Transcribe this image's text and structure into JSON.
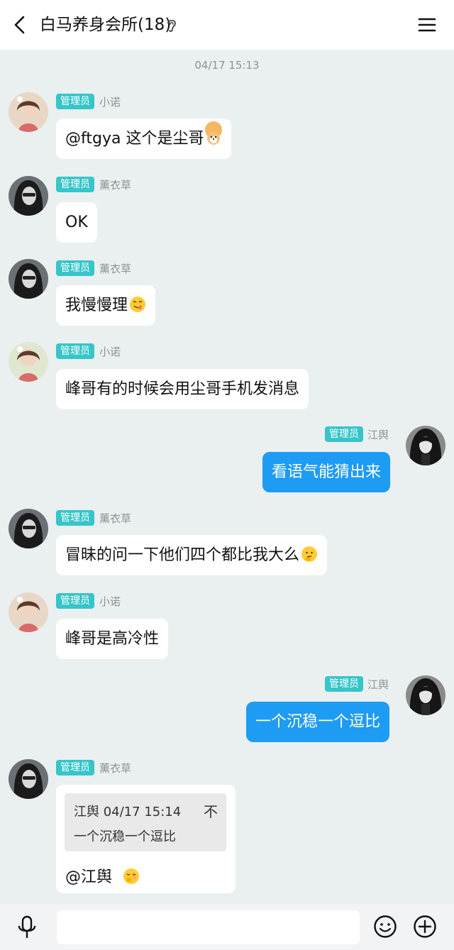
{
  "header": {
    "title": "白马养身会所(18)"
  },
  "timestamp": "04/17 15:13",
  "messages": [
    {
      "badge": "管理员",
      "sender": "小诺",
      "text": "@ftgya 这个是尘哥",
      "emoji": "dog-face-emoji"
    },
    {
      "badge": "管理员",
      "sender": "薰衣草",
      "text": "OK"
    },
    {
      "badge": "管理员",
      "sender": "薰衣草",
      "text": "我慢慢理",
      "emoji": "yum-face-emoji"
    },
    {
      "badge": "管理员",
      "sender": "小诺",
      "text": "峰哥有的时候会用尘哥手机发消息"
    },
    {
      "badge": "管理员",
      "sender": "江舆",
      "text": "看语气能猜出来"
    },
    {
      "badge": "管理员",
      "sender": "薰衣草",
      "text": "冒昧的问一下他们四个都比我大么",
      "emoji": "thinking-face-emoji"
    },
    {
      "badge": "管理员",
      "sender": "小诺",
      "text": "峰哥是高冷性"
    },
    {
      "badge": "管理员",
      "sender": "江舆",
      "text": "一个沉稳一个逗比"
    },
    {
      "badge": "管理员",
      "sender": "薰衣草",
      "quote": {
        "author_time": "江舆 04/17 15:14",
        "arrow": "不",
        "text": "一个沉稳一个逗比"
      },
      "text": "@江舆",
      "emoji": "shy-face-emoji"
    }
  ],
  "colors": {
    "background": "#eaeff0",
    "badge": "#36c5c9",
    "outgoing_bubble": "#1e9bf3",
    "incoming_bubble": "#ffffff"
  },
  "icons": {
    "back": "back-arrow-icon",
    "ear": "ear-icon",
    "menu": "menu-icon",
    "mic": "microphone-icon",
    "emoji": "smiley-icon",
    "add": "plus-circle-icon"
  }
}
